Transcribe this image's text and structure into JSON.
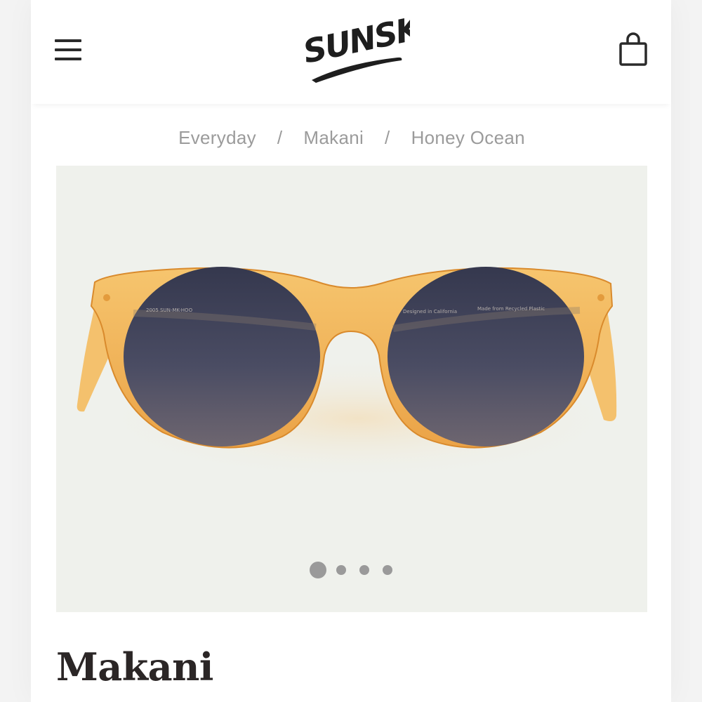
{
  "header": {
    "menu_icon": "hamburger-menu-icon",
    "logo_text": "SUNSKI",
    "cart_icon": "shopping-bag-icon"
  },
  "breadcrumb": {
    "items": [
      "Everyday",
      "Makani",
      "Honey Ocean"
    ],
    "separator": "/"
  },
  "product": {
    "title": "Makani",
    "image": {
      "temple_text_left": "2005 SUN-MK-HOO",
      "temple_text_right_1": "Designed in California",
      "temple_text_right_2": "Made from Recycled Plastic"
    },
    "carousel": {
      "slide_count": 4,
      "active_index": 0
    }
  },
  "colors": {
    "frame": "#f2b65c",
    "lens": "#3e4258",
    "image_background": "#eff1ec",
    "breadcrumb_text": "#9b9b9b",
    "title_text": "#2b2626"
  }
}
